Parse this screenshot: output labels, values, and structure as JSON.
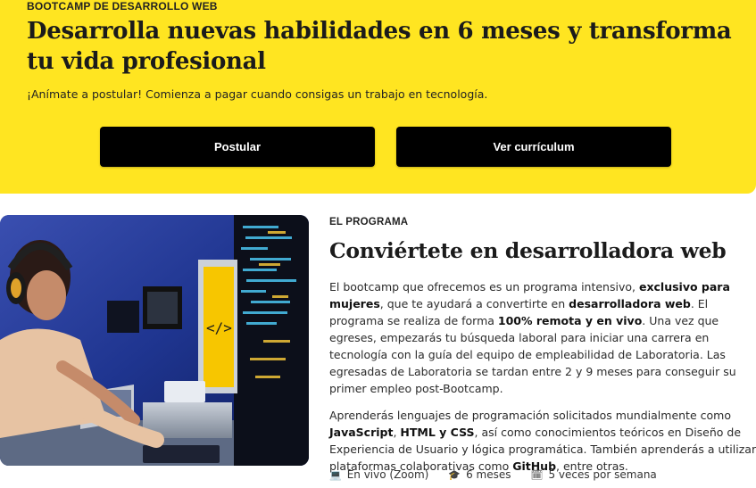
{
  "hero": {
    "eyebrow": "BOOTCAMP DE DESARROLLO WEB",
    "title": "Desarrolla nuevas habilidades en 6 meses y transforma tu vida profesional",
    "subtitle": "¡Anímate a postular! Comienza a pagar cuando consigas un trabajo en tecnología.",
    "apply_label": "Postular",
    "curriculum_label": "Ver currículum",
    "background": "#ffe521"
  },
  "program": {
    "eyebrow": "EL PROGRAMA",
    "title": "Conviértete en desarrolladora web",
    "p1": {
      "t1": "El bootcamp que ofrecemos es un programa intensivo, ",
      "b1": "exclusivo para mujeres",
      "t2": ", que te ayudará a convertirte en ",
      "b2": "desarrolladora web",
      "t3": ". El programa se realiza de forma ",
      "b3": "100% remota y en vivo",
      "t4": ". Una vez que egreses, empezarás tu búsqueda laboral para iniciar una carrera en tecnología con la guía del equipo de empleabilidad de Laboratoria. Las egresadas de Laboratoria se tardan entre 2 y 9 meses para conseguir su primer empleo post-Bootcamp."
    },
    "p2": {
      "t1": "Aprenderás lenguajes de programación solicitados mundialmente como ",
      "b1": "JavaScript",
      "t2": ", ",
      "b2": "HTML y CSS",
      "t3": ", así como conocimientos teóricos en Diseño de Experiencia de Usuario y lógica programática. También aprenderás a utilizar plataformas colaborativas como ",
      "b3": "GitHub",
      "t4": ", entre otras."
    },
    "meta": [
      {
        "icon": "laptop-icon",
        "glyph": "💻",
        "label": "En vivo (Zoom)"
      },
      {
        "icon": "graduation-cap-icon",
        "glyph": "🎓",
        "label": "6 meses"
      },
      {
        "icon": "calendar-icon",
        "glyph": "🗓",
        "label": "5 veces por semana"
      }
    ]
  }
}
